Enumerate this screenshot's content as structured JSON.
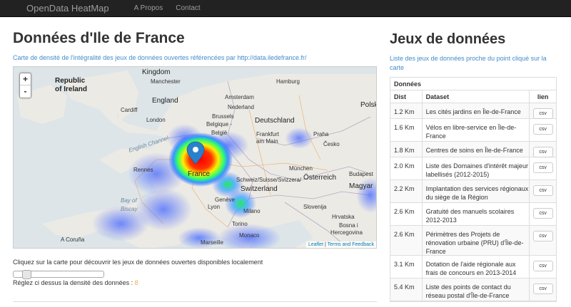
{
  "navbar": {
    "brand": "OpenData HeatMap",
    "links": [
      "A Propos",
      "Contact"
    ]
  },
  "main": {
    "title": "Données d'Ile de France",
    "description": "Carte de densité de l'intégralité des jeux de données ouvertes référencées par http://data.iledefrance.fr/",
    "instructions": "Cliquez sur la carte pour découvrir les jeux de données ouvertes disponibles localement",
    "density_label": "Réglez ci dessus la densité des données :",
    "density_value": "8"
  },
  "map": {
    "zoom_in": "+",
    "zoom_out": "-",
    "attribution_leaflet": "Leaflet",
    "attribution_sep": " | ",
    "attribution_terms": "Terms and Feedback",
    "labels": {
      "kingdom": "Kingdom",
      "republic": "Republic",
      "of_ireland": "of Ireland",
      "manchester": "Manchester",
      "england": "England",
      "cardiff": "Cardiff",
      "london": "London",
      "amsterdam": "Amsterdam",
      "hamburg": "Hamburg",
      "nederland": "Nederland",
      "brussels": "Brussels",
      "belgique": "Belgique -",
      "belgie": "België",
      "deutschland": "Deutschland",
      "frankfurt": "Frankfurt",
      "am_main": "am Main",
      "praha": "Praha",
      "cesko": "Česko",
      "polska": "Polsk",
      "rennes": "Rennes",
      "france": "France",
      "munchen": "München",
      "osterreich": "Österreich",
      "schweiz": "Schweiz/Suisse/Svizzera/",
      "switzerland": "Switzerland",
      "geneve": "Genève",
      "lyon": "Lyon",
      "milano": "Milano",
      "torino": "Torino",
      "monaco": "Monaco",
      "marseille": "Marseille",
      "bay_of": "Bay of",
      "biscay": "Biscay",
      "a_coruna": "A Coruña",
      "slovenija": "Slovenija",
      "hrvatska": "Hrvatska",
      "bosna": "Bosna i",
      "hercegovina": "Hercegovina",
      "budapest": "Budapest",
      "magyar": "Magyar",
      "english_channel": "English Channel"
    }
  },
  "sidebar": {
    "title": "Jeux de données",
    "description": "Liste des jeux de données proche du point cliqué sur la carte",
    "table_caption": "Données",
    "columns": [
      "Dist",
      "Dataset",
      "lien"
    ],
    "rows": [
      {
        "dist": "1.2 Km",
        "dataset": "Les cités jardins en Île-de-France",
        "link": "csv"
      },
      {
        "dist": "1.6 Km",
        "dataset": "Vélos en libre-service en Île-de-France",
        "link": "csv"
      },
      {
        "dist": "1.8 Km",
        "dataset": "Centres de soins en Île-de-France",
        "link": "csv"
      },
      {
        "dist": "2.0 Km",
        "dataset": "Liste des Domaines d'intérêt majeur labellisés (2012-2015)",
        "link": "csv"
      },
      {
        "dist": "2.2 Km",
        "dataset": "Implantation des services régionaux du siège de la Région",
        "link": "csv"
      },
      {
        "dist": "2.6 Km",
        "dataset": "Gratuité des manuels scolaires 2012-2013",
        "link": "csv"
      },
      {
        "dist": "2.6 Km",
        "dataset": "Périmètres des Projets de rénovation urbaine (PRU) d'Île-de-France",
        "link": "csv"
      },
      {
        "dist": "3.1 Km",
        "dataset": "Dotation de l'aide régionale aux frais de concours en 2013-2014",
        "link": "csv"
      },
      {
        "dist": "5.4 Km",
        "dataset": "Liste des points de contact du réseau postal d'Île-de-France",
        "link": "csv"
      }
    ]
  }
}
